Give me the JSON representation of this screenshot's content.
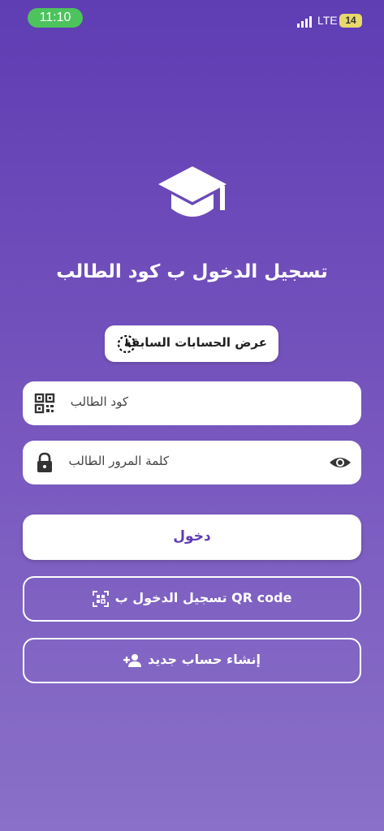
{
  "status_bar": {
    "time": "11:10",
    "network": "LTE",
    "battery": "14"
  },
  "header": {
    "icon": "graduation-cap-icon",
    "title": "تسجيل الدخول ب كود الطالب"
  },
  "previous_accounts": {
    "label": "عرض الحسابات السابقة",
    "icon": "history-icon"
  },
  "form": {
    "student_code_placeholder": "كود الطالب",
    "password_placeholder": "كلمة المرور الطالب"
  },
  "actions": {
    "login_label": "دخول",
    "qr_login_label": "تسجيل الدخول ب QR code",
    "create_account_label": "إنشاء حساب جديد"
  },
  "colors": {
    "background_top": "#5f3db3",
    "background_bottom": "#8a70c8",
    "accent": "#5e3cb2",
    "status_time_bg": "#4cc35d",
    "battery_bg": "#e8d96b"
  }
}
